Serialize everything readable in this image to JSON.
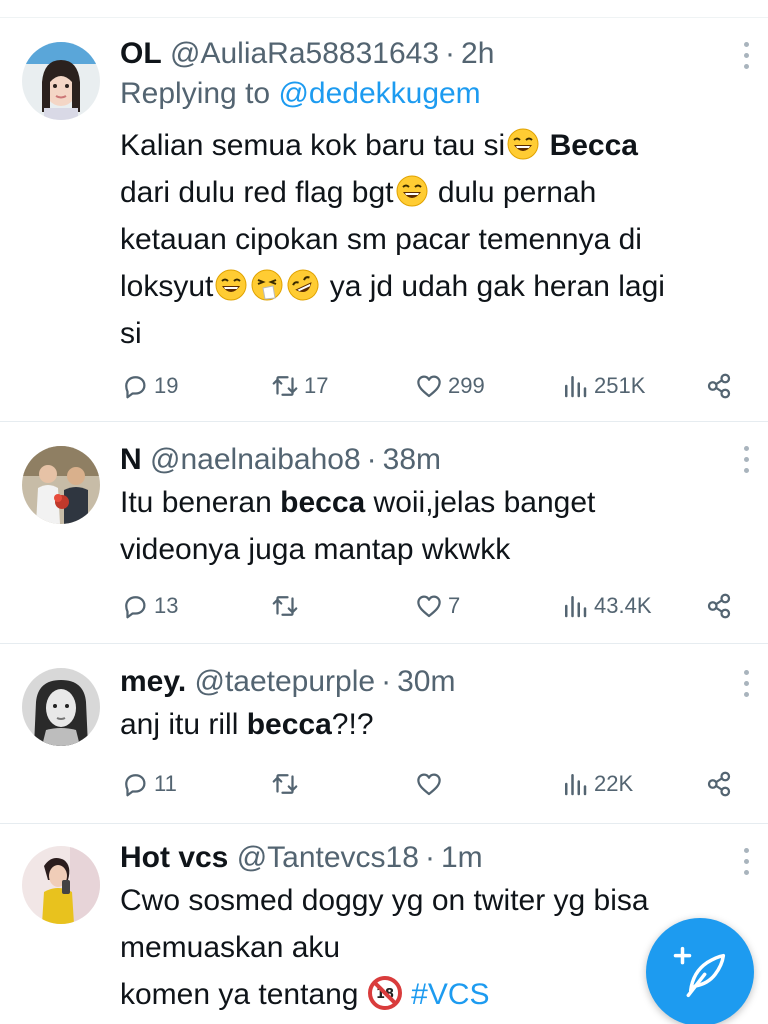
{
  "tweets": [
    {
      "name": "OL",
      "handle": "@AuliaRa58831643",
      "time": "2h",
      "replying_label": "Replying to",
      "replying_to": "@dedekkugem",
      "line1_pre": "Kalian semua kok baru tau si",
      "line1_bold": "Becca",
      "line2_pre": "dari dulu red flag bgt",
      "line2_post": " dulu pernah",
      "line3": "ketauan cipokan sm pacar temennya di",
      "line4_pre": "loksyut",
      "line4_post": " ya jd udah gak heran lagi",
      "line5": "si",
      "replies": "19",
      "retweets": "17",
      "likes": "299",
      "views": "251K"
    },
    {
      "name": "N",
      "handle": "@naelnaibaho8",
      "time": "38m",
      "line1_pre": "Itu beneran ",
      "line1_bold": "becca",
      "line1_post": " woii,jelas banget",
      "line2": "videonya juga mantap wkwkk",
      "replies": "13",
      "retweets": "",
      "likes": "7",
      "views": "43.4K"
    },
    {
      "name": "mey.",
      "handle": "@taetepurple",
      "time": "30m",
      "line1_pre": "anj itu rill ",
      "line1_bold": "becca",
      "line1_post": "?!?",
      "replies": "11",
      "retweets": "",
      "likes": "",
      "views": "22K"
    },
    {
      "name": "Hot vcs",
      "handle": "@Tantevcs18",
      "time": "1m",
      "line1": "Cwo sosmed doggy yg on twiter yg bisa",
      "line2": "memuaskan  aku",
      "line3_pre": "komen ya tentang ",
      "hashtag": "#VCS"
    }
  ],
  "separator": "·",
  "icons": {
    "reply": "reply-icon",
    "retweet": "retweet-icon",
    "like": "heart-icon",
    "views": "views-icon",
    "share": "share-icon",
    "more": "more-icon",
    "compose": "compose-icon",
    "laugh": "laughing-emoji",
    "sneeze": "sneezing-emoji",
    "rofl": "rofl-emoji",
    "no_under_18": "no-under-18-emoji"
  },
  "colors": {
    "accent": "#1d9bf0",
    "text": "#0f1419",
    "secondary": "#536471"
  }
}
